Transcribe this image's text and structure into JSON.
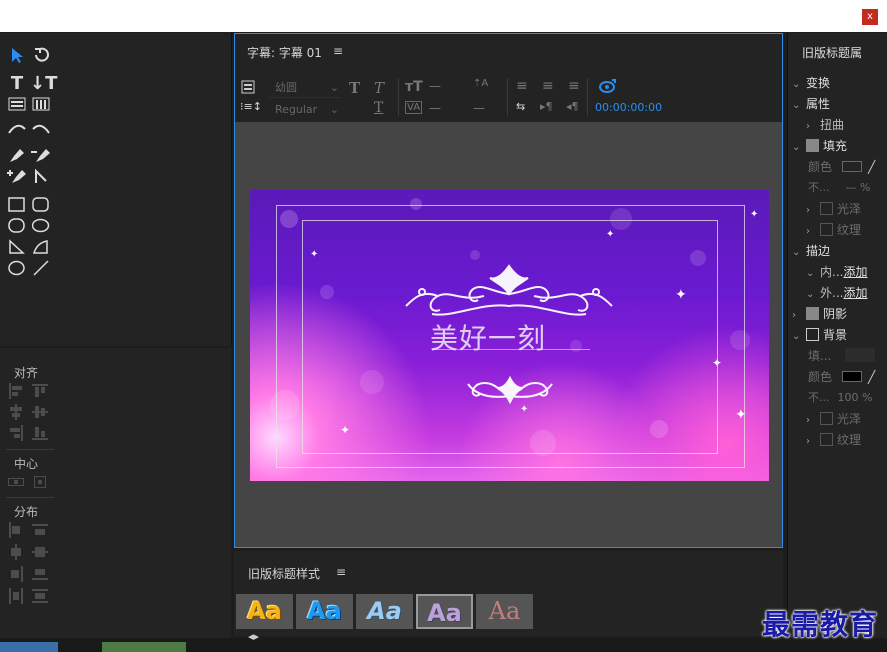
{
  "window": {
    "close_label": "x"
  },
  "title_panel": {
    "tab_label": "字幕: 字幕 01",
    "menu_glyph": "≡",
    "font_family_placeholder": "幼圆",
    "font_style_placeholder": "Regular",
    "timecode": "00:00:00:00",
    "dash": "—",
    "preview_text": "美好一刻",
    "accent_color": "#2d8ceb"
  },
  "align_panel": {
    "align_label": "对齐",
    "center_label": "中心",
    "distribute_label": "分布"
  },
  "styles_panel": {
    "tab_label": "旧版标题样式",
    "menu_glyph": "≡",
    "swatches": [
      "Aa",
      "Aa",
      "Aa",
      "Aa",
      "Aa"
    ]
  },
  "properties": {
    "header": "旧版标题属",
    "transform": "变换",
    "attributes": "属性",
    "distort": "扭曲",
    "fill": "填充",
    "color": "颜色",
    "opacity": "不...",
    "opacity_value": "— %",
    "sheen": "光泽",
    "texture": "纹理",
    "strokes": "描边",
    "inner": "内...",
    "outer": "外...",
    "add": "添加",
    "shadow": "阴影",
    "background": "背景",
    "bg_fill": "填...",
    "bg_color": "颜色",
    "bg_opacity": "不...",
    "bg_opacity_value": "100 %",
    "bg_sheen": "光泽",
    "bg_texture": "纹理"
  },
  "watermark": "最需教育"
}
